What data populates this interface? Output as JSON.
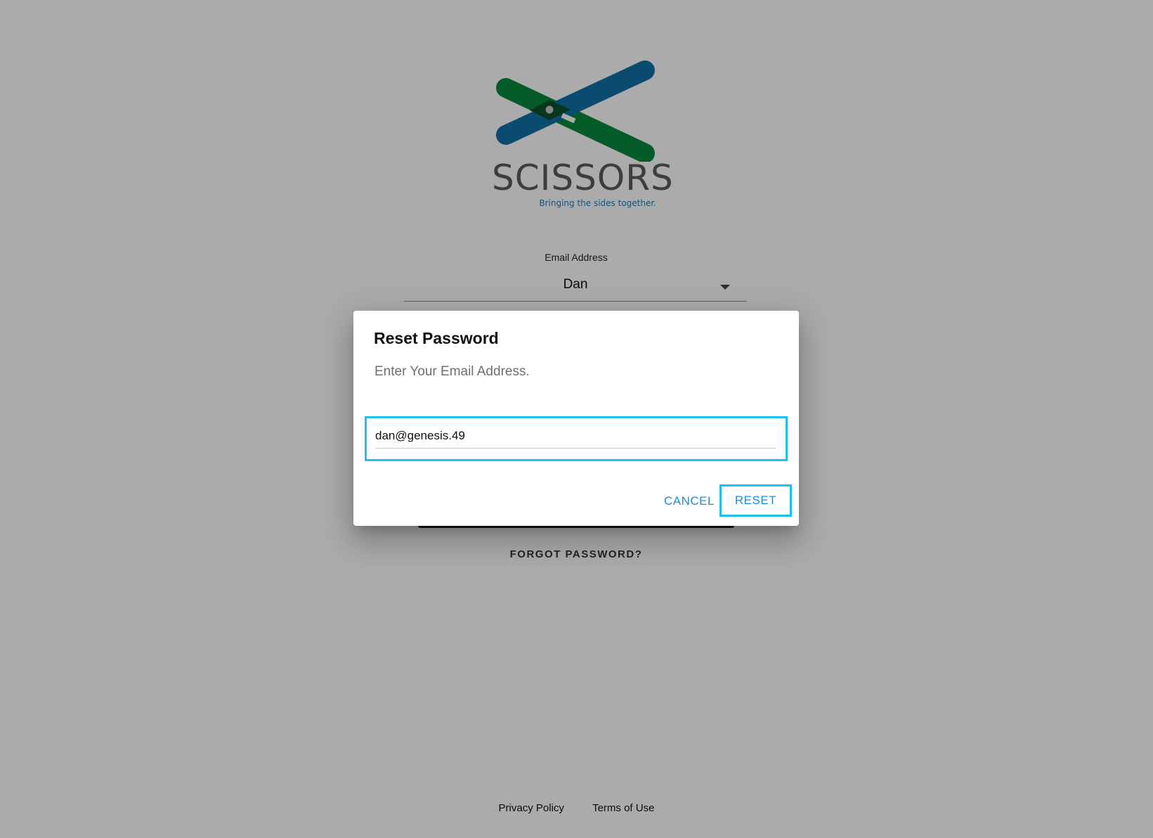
{
  "logo": {
    "wordmark": "SCISSORS",
    "tagline": "Bringing the sides together.",
    "colors": {
      "green": "#0a8a3e",
      "blue": "#1170a8",
      "dark": "#5b5b5b"
    }
  },
  "login": {
    "email_label": "Email Address",
    "email_selected": "Dan",
    "forgot_password": "FORGOT PASSWORD?"
  },
  "dialog": {
    "title": "Reset Password",
    "text": "Enter Your Email Address.",
    "email_value": "dan@genesis.49",
    "cancel_label": "CANCEL",
    "reset_label": "RESET",
    "focus_color": "#1ec0f2",
    "accent_color": "#1a8fd8"
  },
  "footer": {
    "privacy": "Privacy Policy",
    "terms": "Terms of Use"
  }
}
